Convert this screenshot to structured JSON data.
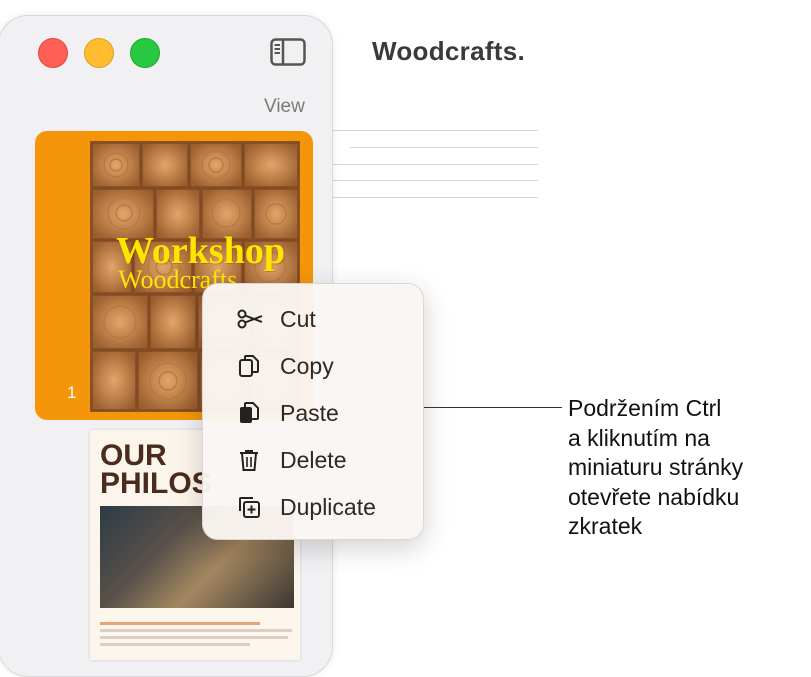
{
  "window": {
    "title": "Woodcrafts."
  },
  "sidebar": {
    "toggle_icon": "sidebar-toggle-icon",
    "view_label": "View",
    "pages": [
      {
        "number": "1",
        "cover_title": "Workshop",
        "cover_subtitle": "Woodcrafts"
      },
      {
        "heading_line1": "OUR",
        "heading_line2": "PHILOS"
      }
    ]
  },
  "context_menu": {
    "items": [
      {
        "label": "Cut",
        "icon": "scissors-icon"
      },
      {
        "label": "Copy",
        "icon": "copy-icon"
      },
      {
        "label": "Paste",
        "icon": "paste-icon"
      },
      {
        "label": "Delete",
        "icon": "trash-icon"
      },
      {
        "label": "Duplicate",
        "icon": "duplicate-icon"
      }
    ]
  },
  "callout": {
    "lines": [
      "Podržením Ctrl",
      "a kliknutím na",
      "miniaturu stránky",
      "otevřete nabídku",
      "zkratek"
    ]
  },
  "colors": {
    "selection": "#f5960a",
    "cover_title": "#ffe600",
    "close": "#ff5f57",
    "minimize": "#febc2e",
    "zoom": "#28c840"
  }
}
